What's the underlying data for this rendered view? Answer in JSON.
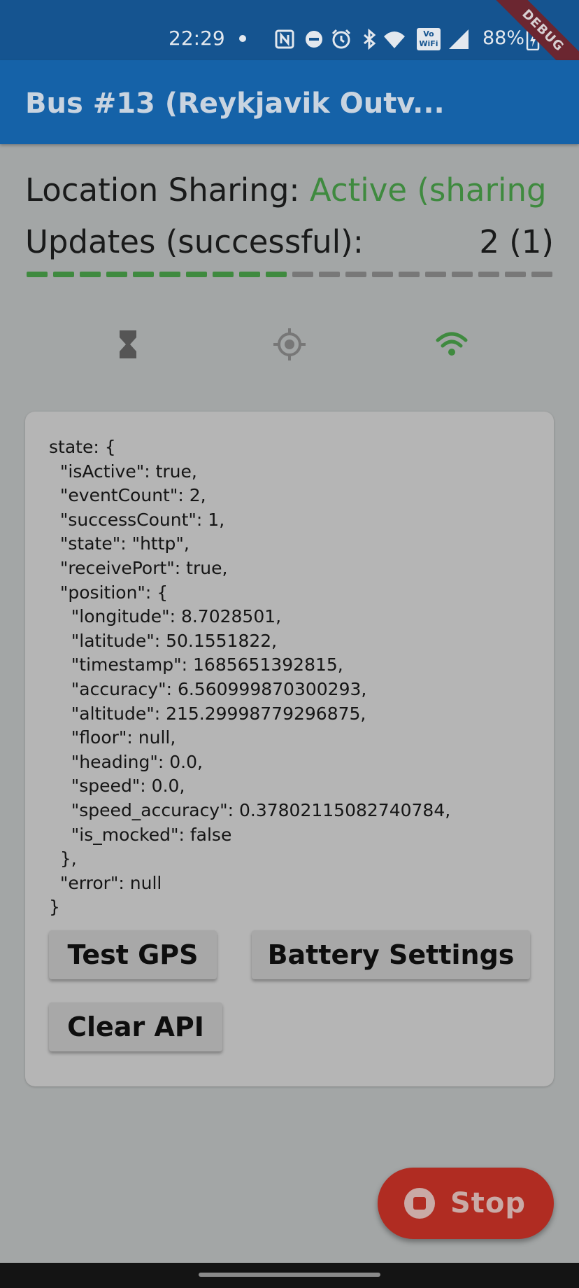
{
  "status_bar": {
    "time": "22:29",
    "battery": "88%",
    "debug_banner": "DEBUG",
    "icons": [
      "dot-icon",
      "nfc-icon",
      "do-not-disturb-icon",
      "alarm-icon",
      "bluetooth-icon",
      "wifi-icon",
      "vowifi-icon",
      "signal-icon",
      "battery-icon"
    ],
    "vowifi_top": "Vo",
    "vowifi_bottom": "WiFi"
  },
  "app_bar": {
    "title": "Bus #13 (Reykjavik Outv..."
  },
  "sharing": {
    "label": "Location Sharing:",
    "value": "Active (sharing",
    "value_color": "#3f8a3f"
  },
  "updates": {
    "label": "Updates (successful):",
    "count": "2 (1)",
    "progress_total_segments": 20,
    "progress_filled_segments": 10,
    "filled_color": "#3f8a3f",
    "empty_color": "#787878"
  },
  "status_icons": {
    "items": [
      {
        "name": "hourglass-icon",
        "color": "#555555"
      },
      {
        "name": "gps-target-icon",
        "color": "#777777"
      },
      {
        "name": "wifi-icon",
        "color": "#3f8a3f"
      }
    ]
  },
  "state_card": {
    "json_text": "state: {\n  \"isActive\": true,\n  \"eventCount\": 2,\n  \"successCount\": 1,\n  \"state\": \"http\",\n  \"receivePort\": true,\n  \"position\": {\n    \"longitude\": 8.7028501,\n    \"latitude\": 50.1551822,\n    \"timestamp\": 1685651392815,\n    \"accuracy\": 6.560999870300293,\n    \"altitude\": 215.29998779296875,\n    \"floor\": null,\n    \"heading\": 0.0,\n    \"speed\": 0.0,\n    \"speed_accuracy\": 0.37802115082740784,\n    \"is_mocked\": false\n  },\n  \"error\": null\n}",
    "buttons": {
      "test_gps": "Test GPS",
      "battery_settings": "Battery Settings",
      "clear_api": "Clear API"
    }
  },
  "fab": {
    "label": "Stop",
    "icon": "stop-circle-icon",
    "color": "#b02c22"
  }
}
